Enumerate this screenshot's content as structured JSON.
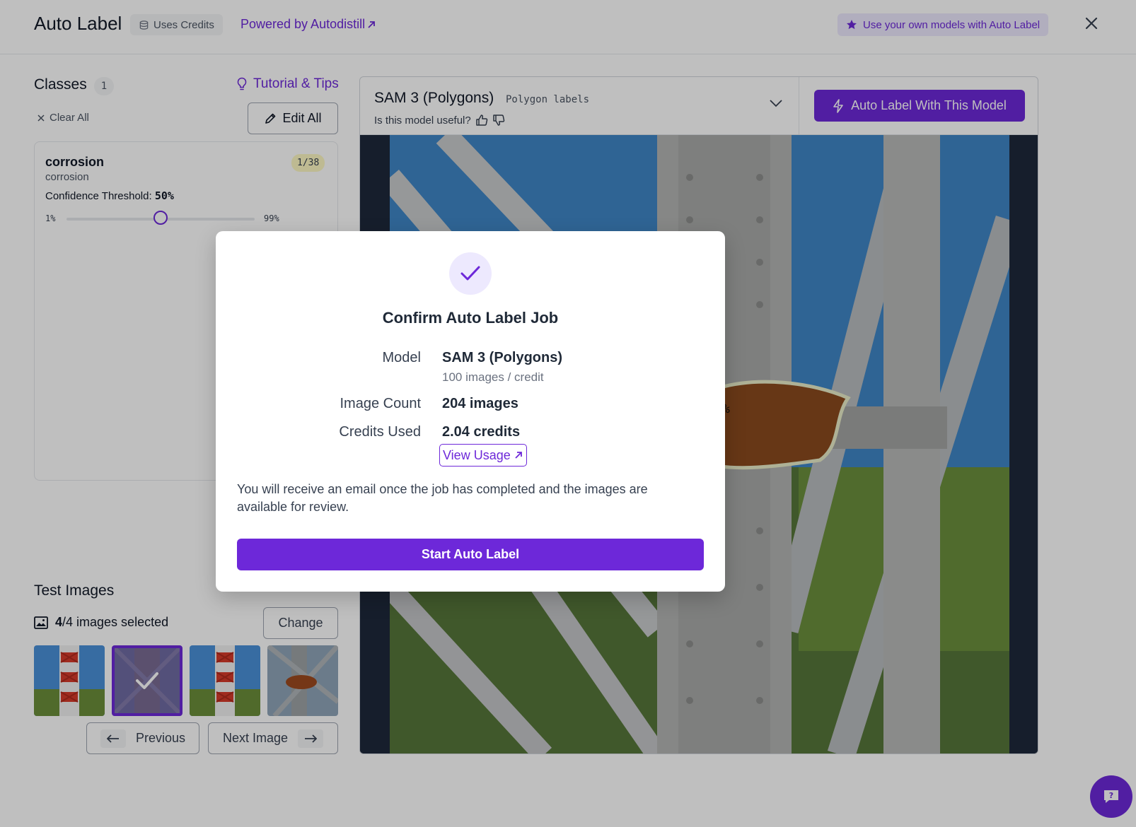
{
  "header": {
    "title": "Auto Label",
    "credits_badge": "Uses Credits",
    "powered_by": "Powered by Autodistill",
    "own_models": "Use your own models with Auto Label"
  },
  "classes": {
    "title": "Classes",
    "count": "1",
    "tutorial": "Tutorial & Tips",
    "clear_all": "Clear All",
    "edit_all": "Edit All",
    "items": [
      {
        "name": "corrosion",
        "subtitle": "corrosion",
        "ratio": "1/38",
        "confidence_label": "Confidence Threshold:",
        "confidence_value": "50%",
        "slider_min": "1%",
        "slider_max": "99%",
        "slider_fraction": 0.5
      }
    ]
  },
  "test_images": {
    "title": "Test Images",
    "count": "4",
    "count_text": "/4 images selected",
    "change": "Change",
    "previous": "Previous",
    "next": "Next Image"
  },
  "model": {
    "name": "SAM 3 (Polygons)",
    "tag": "Polygon labels",
    "useful": "Is this model useful?",
    "auto_label_button": "Auto Label With This Model",
    "confidence_overlay": "%"
  },
  "modal": {
    "title": "Confirm Auto Label Job",
    "model_label": "Model",
    "model_value": "SAM 3 (Polygons)",
    "model_rate": "100 images / credit",
    "image_count_label": "Image Count",
    "image_count_value": "204 images",
    "credits_label": "Credits Used",
    "credits_value": "2.04 credits",
    "view_usage": "View Usage",
    "note": "You will receive an email once the job has completed and the images are available for review.",
    "start_button": "Start Auto Label"
  },
  "colors": {
    "accent": "#6d28d9",
    "accent_light": "#ede9fe"
  }
}
